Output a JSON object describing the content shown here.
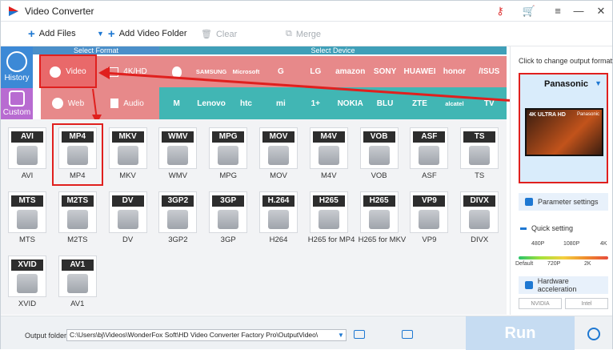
{
  "app": {
    "title": "Video Converter"
  },
  "toolbar": {
    "add_files": "Add Files",
    "add_video_folder": "Add Video Folder",
    "clear": "Clear",
    "merge": "Merge"
  },
  "sidebar": {
    "history": "History",
    "custom": "Custom"
  },
  "headers": {
    "select_format": "Select Format",
    "select_device": "Select Device"
  },
  "format_tabs": {
    "video": "Video",
    "hd": "4K/HD",
    "web": "Web",
    "audio": "Audio"
  },
  "devices_row1": [
    {
      "label": "",
      "icon": "apple-icon"
    },
    {
      "label": "SAMSUNG",
      "icon": "samsung-logo"
    },
    {
      "label": "Microsoft",
      "icon": "microsoft-logo"
    },
    {
      "label": "G",
      "icon": "google-icon"
    },
    {
      "label": "LG",
      "icon": "lg-logo"
    },
    {
      "label": "amazon",
      "icon": "amazon-logo"
    },
    {
      "label": "SONY",
      "icon": "sony-logo"
    },
    {
      "label": "HUAWEI",
      "icon": "huawei-logo"
    },
    {
      "label": "honor",
      "icon": "honor-logo"
    },
    {
      "label": "/ISUS",
      "icon": "asus-logo"
    }
  ],
  "devices_row2": [
    {
      "label": "M",
      "icon": "motorola-icon"
    },
    {
      "label": "Lenovo",
      "icon": "lenovo-logo"
    },
    {
      "label": "htc",
      "icon": "htc-logo"
    },
    {
      "label": "mi",
      "icon": "xiaomi-logo"
    },
    {
      "label": "1+",
      "icon": "oneplus-logo"
    },
    {
      "label": "NOKIA",
      "icon": "nokia-logo"
    },
    {
      "label": "BLU",
      "icon": "blu-logo"
    },
    {
      "label": "ZTE",
      "icon": "zte-logo"
    },
    {
      "label": "alcatel",
      "icon": "alcatel-logo"
    },
    {
      "label": "TV",
      "icon": "tv-icon"
    }
  ],
  "formats_row1": [
    {
      "tag": "AVI",
      "label": "AVI"
    },
    {
      "tag": "MP4",
      "label": "MP4"
    },
    {
      "tag": "MKV",
      "label": "MKV"
    },
    {
      "tag": "WMV",
      "label": "WMV"
    },
    {
      "tag": "MPG",
      "label": "MPG"
    },
    {
      "tag": "MOV",
      "label": "MOV"
    },
    {
      "tag": "M4V",
      "label": "M4V"
    },
    {
      "tag": "VOB",
      "label": "VOB"
    },
    {
      "tag": "ASF",
      "label": "ASF"
    },
    {
      "tag": "TS",
      "label": "TS"
    }
  ],
  "formats_row2": [
    {
      "tag": "MTS",
      "label": "MTS"
    },
    {
      "tag": "M2TS",
      "label": "M2TS"
    },
    {
      "tag": "DV",
      "label": "DV"
    },
    {
      "tag": "3GP2",
      "label": "3GP2"
    },
    {
      "tag": "3GP",
      "label": "3GP"
    },
    {
      "tag": "H.264",
      "label": "H264"
    },
    {
      "tag": "H265",
      "label": "H265 for MP4"
    },
    {
      "tag": "H265",
      "label": "H265 for MKV"
    },
    {
      "tag": "VP9",
      "label": "VP9"
    },
    {
      "tag": "DIVX",
      "label": "DIVX"
    }
  ],
  "formats_row3": [
    {
      "tag": "XVID",
      "label": "XVID"
    },
    {
      "tag": "AV1",
      "label": "AV1"
    }
  ],
  "right_panel": {
    "hint": "Click to change output format:",
    "device_name": "Panasonic",
    "tv_brand": "Panasonic",
    "tv_badge": "4K ULTRA HD",
    "parameter_settings": "Parameter settings",
    "quick_setting": "Quick setting",
    "ticks_top": [
      "480P",
      "1080P",
      "4K"
    ],
    "ticks_bottom": [
      "Default",
      "720P",
      "2K"
    ],
    "hardware_acceleration": "Hardware acceleration",
    "nvidia": "NVIDIA",
    "intel": "Intel"
  },
  "bottom": {
    "output_folder_label": "Output folder:",
    "output_path": "C:\\Users\\bj\\Videos\\WonderFox Soft\\HD Video Converter Factory Pro\\OutputVideo\\",
    "run": "Run"
  },
  "colors": {
    "format_header": "#4b8fc9",
    "video_tab": "#e9696a",
    "device_row": "#e7898a",
    "device_row2": "#41b6b4",
    "history": "#3c89d6",
    "custom": "#b86bd1",
    "highlight": "#e0201e"
  }
}
